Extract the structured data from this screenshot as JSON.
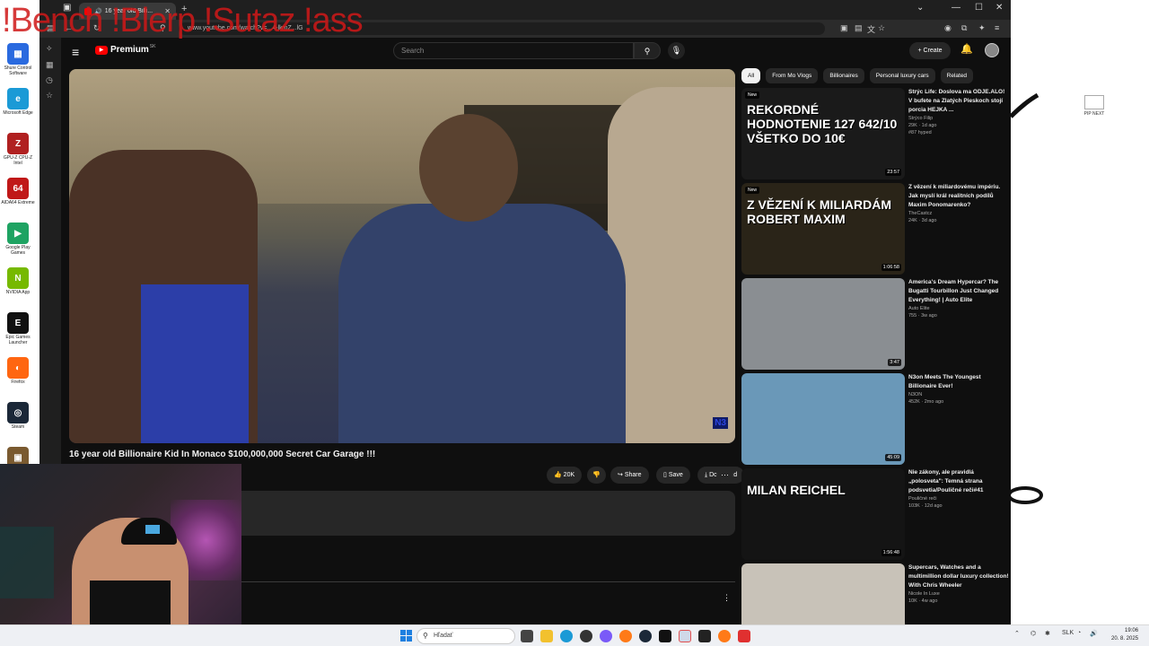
{
  "overlay": {
    "title": "!Bench !Blerp !Sutaz !ass"
  },
  "desktop": {
    "icons": [
      {
        "label": "Shure Control Software",
        "color": "#2a6adf",
        "glyph": "▦"
      },
      {
        "label": "Microsoft Edge",
        "color": "#1b9ad6",
        "glyph": "e"
      },
      {
        "label": "GPU-Z CPU-Z Intel",
        "color": "#b02020",
        "glyph": "Z"
      },
      {
        "label": "AIDA64 Extreme",
        "color": "#c01818",
        "glyph": "64"
      },
      {
        "label": "Google Play Games",
        "color": "#1ea362",
        "glyph": "▶"
      },
      {
        "label": "NVIDIA App",
        "color": "#76b900",
        "glyph": "N"
      },
      {
        "label": "Epic Games Launcher",
        "color": "#111111",
        "glyph": "E"
      },
      {
        "label": "Firefox",
        "color": "#ff6611",
        "glyph": "◐"
      },
      {
        "label": "Steam",
        "color": "#1b2838",
        "glyph": "◎"
      },
      {
        "label": "",
        "color": "#7a5a30",
        "glyph": "▣"
      }
    ],
    "right_icon_label": "PIP NEXT"
  },
  "browser": {
    "tab_title": "16 year old Billi...",
    "url": "www.youtube.com/watch?v=...4-lkmZ...lG"
  },
  "youtube": {
    "logo": "Premium",
    "logo_sup": "SK",
    "search_placeholder": "Search",
    "create_label": "Create",
    "video_title": "16 year old Billionaire Kid In Monaco $100,000,000 Secret Car Garage !!!",
    "watermark": "N3",
    "actions": {
      "likes": "20K",
      "share": "Share",
      "save": "Save",
      "download": "Download"
    },
    "chips": [
      "All",
      "From Mo Vlogs",
      "Billionaires",
      "Personal luxury cars",
      "Related"
    ],
    "recommendations": [
      {
        "title": "Strýc Life: Doslova ma ODJE.ALO! V bufete na Zlatých Pieskoch stojí porcia HEJKA ...",
        "channel": "Strýco Filip",
        "stats": "29K · 1d ago",
        "extra": "#87 hyped",
        "duration": "23:57",
        "new": "New",
        "thumb_text": "REKORDNÉ HODNOTENIE 127 642/10 VŠETKO DO 10€",
        "thumb_color": "#1a1a1a"
      },
      {
        "title": "Z vězení k miliardovému impériu. Jak myslí král realitních podílů Maxim Ponomarenko?",
        "channel": "TheCastcz",
        "stats": "24K · 3d ago",
        "extra": "",
        "duration": "1:06:58",
        "new": "New",
        "thumb_text": "Z VĚZENÍ K MILIARDÁM ROBERT MAXIM",
        "thumb_color": "#2a2418"
      },
      {
        "title": "America's Dream Hypercar? The Bugatti Tourbillon Just Changed Everything! | Auto Elite",
        "channel": "Auto Elite",
        "stats": "755 · 3w ago",
        "extra": "",
        "duration": "3:47",
        "new": "",
        "thumb_text": "",
        "thumb_color": "#8a8e92"
      },
      {
        "title": "N3on Meets The Youngest Billionaire Ever!",
        "channel": "N3ON",
        "stats": "452K · 2mo ago",
        "extra": "",
        "duration": "45:09",
        "new": "",
        "thumb_text": "",
        "thumb_color": "#6a98b8"
      },
      {
        "title": "Nie zákony, ale pravidlá „polosveta\": Temná strana podsvetia/Pouličné reči#41",
        "channel": "Pouličné reči",
        "stats": "103K · 12d ago",
        "extra": "",
        "duration": "1:56:48",
        "new": "",
        "thumb_text": "MILAN REICHEL",
        "thumb_color": "#141414"
      },
      {
        "title": "Supercars, Watches and a multimillion dollar luxury collection! With Chris Wheeler",
        "channel": "Nicole In Luxe",
        "stats": "10K · 4w ago",
        "extra": "",
        "duration": "",
        "new": "",
        "thumb_text": "",
        "thumb_color": "#c8c2b8"
      }
    ]
  },
  "taskbar": {
    "search_placeholder": "Hľadať",
    "lang": "SLK",
    "time": "19:06",
    "date": "20. 8. 2025"
  }
}
